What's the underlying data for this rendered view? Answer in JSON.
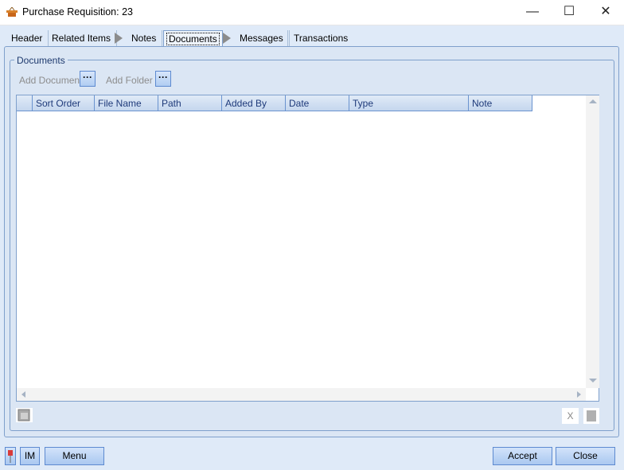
{
  "window": {
    "title": "Purchase Requisition: 23",
    "minimize": "—",
    "maximize": "☐",
    "close": "✕"
  },
  "tabs": [
    {
      "label": "Header"
    },
    {
      "label": "Related Items"
    },
    {
      "label": "Notes"
    },
    {
      "label": "Documents"
    },
    {
      "label": "Messages"
    },
    {
      "label": "Transactions"
    }
  ],
  "group": {
    "label": "Documents",
    "add_document": "Add Document",
    "add_folder": "Add Folder",
    "browse": "···"
  },
  "grid": {
    "columns": [
      "Sort Order",
      "File Name",
      "Path",
      "Added By",
      "Date",
      "Type",
      "Note"
    ]
  },
  "footer": {
    "delete": "X",
    "im": "IM",
    "menu": "Menu",
    "accept": "Accept",
    "close": "Close"
  }
}
